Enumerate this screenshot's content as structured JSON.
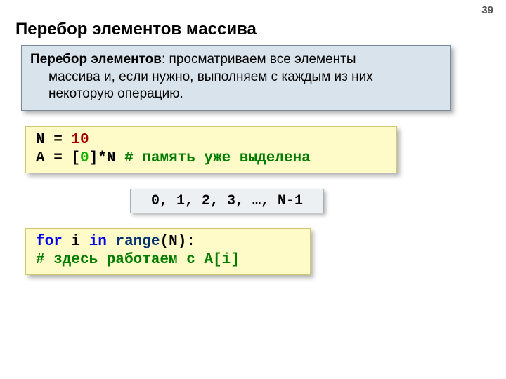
{
  "page_number": "39",
  "title": "Перебор элементов массива",
  "desc": {
    "lead": "Перебор элементов",
    "rest1": ": просматриваем все элементы",
    "line2": "массива и, если нужно, выполняем с каждым из них",
    "line3": "некоторую операцию."
  },
  "code1": {
    "n_var": "N",
    "eq1": " = ",
    "ten": "10",
    "a_var": "A",
    "eq2": " = ",
    "lb": "[",
    "zero": "0",
    "rbstar": "]*N",
    "sp": "  ",
    "comment": "# память уже выделена"
  },
  "sequence": "0, 1, 2, 3, …, N-1",
  "code2": {
    "for_kw": "for",
    "sp1": " ",
    "ivar": "i",
    "sp2": " ",
    "in_kw": "in",
    "sp3": " ",
    "range_kw": "range",
    "paren": "(N):",
    "indent": "  ",
    "comment": "# здесь работаем с A[i]"
  }
}
